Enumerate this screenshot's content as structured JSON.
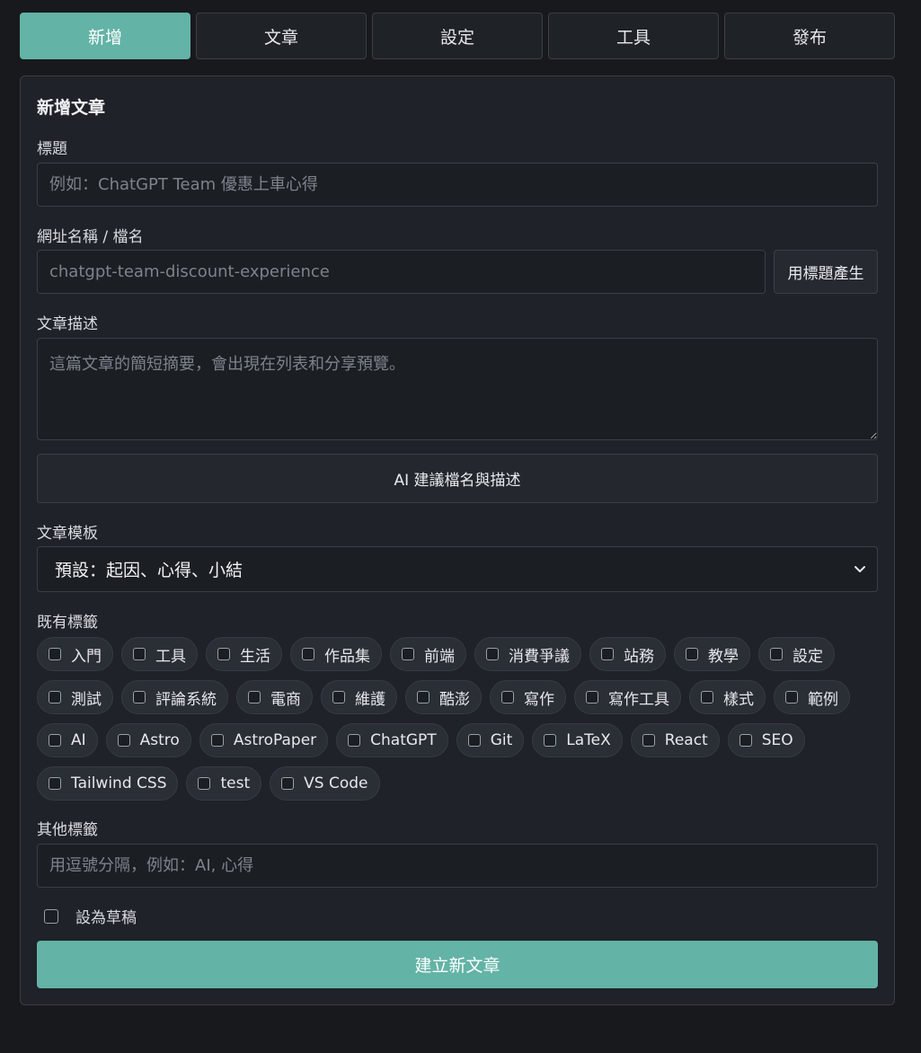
{
  "tabs": [
    {
      "label": "新增",
      "active": true
    },
    {
      "label": "文章",
      "active": false
    },
    {
      "label": "設定",
      "active": false
    },
    {
      "label": "工具",
      "active": false
    },
    {
      "label": "發布",
      "active": false
    }
  ],
  "form": {
    "heading": "新增文章",
    "title_label": "標題",
    "title_placeholder": "例如：ChatGPT Team 優惠上車心得",
    "slug_label": "網址名稱 / 檔名",
    "slug_placeholder": "chatgpt-team-discount-experience",
    "slug_generate_button": "用標題產生",
    "description_label": "文章描述",
    "description_placeholder": "這篇文章的簡短摘要，會出現在列表和分享預覽。",
    "ai_suggest_button": "AI 建議檔名與描述",
    "template_label": "文章模板",
    "template_selected": "預設：起因、心得、小結",
    "existing_tags_label": "既有標籤",
    "tags": [
      "入門",
      "工具",
      "生活",
      "作品集",
      "前端",
      "消費爭議",
      "站務",
      "教學",
      "設定",
      "測試",
      "評論系統",
      "電商",
      "維護",
      "酷澎",
      "寫作",
      "寫作工具",
      "樣式",
      "範例",
      "AI",
      "Astro",
      "AstroPaper",
      "ChatGPT",
      "Git",
      "LaTeX",
      "React",
      "SEO",
      "Tailwind CSS",
      "test",
      "VS Code"
    ],
    "other_tags_label": "其他標籤",
    "other_tags_placeholder": "用逗號分隔，例如：AI, 心得",
    "draft_label": "設為草稿",
    "submit_button": "建立新文章"
  },
  "colors": {
    "accent": "#63b3a6",
    "background": "#17191d",
    "panel": "#1f2228"
  }
}
